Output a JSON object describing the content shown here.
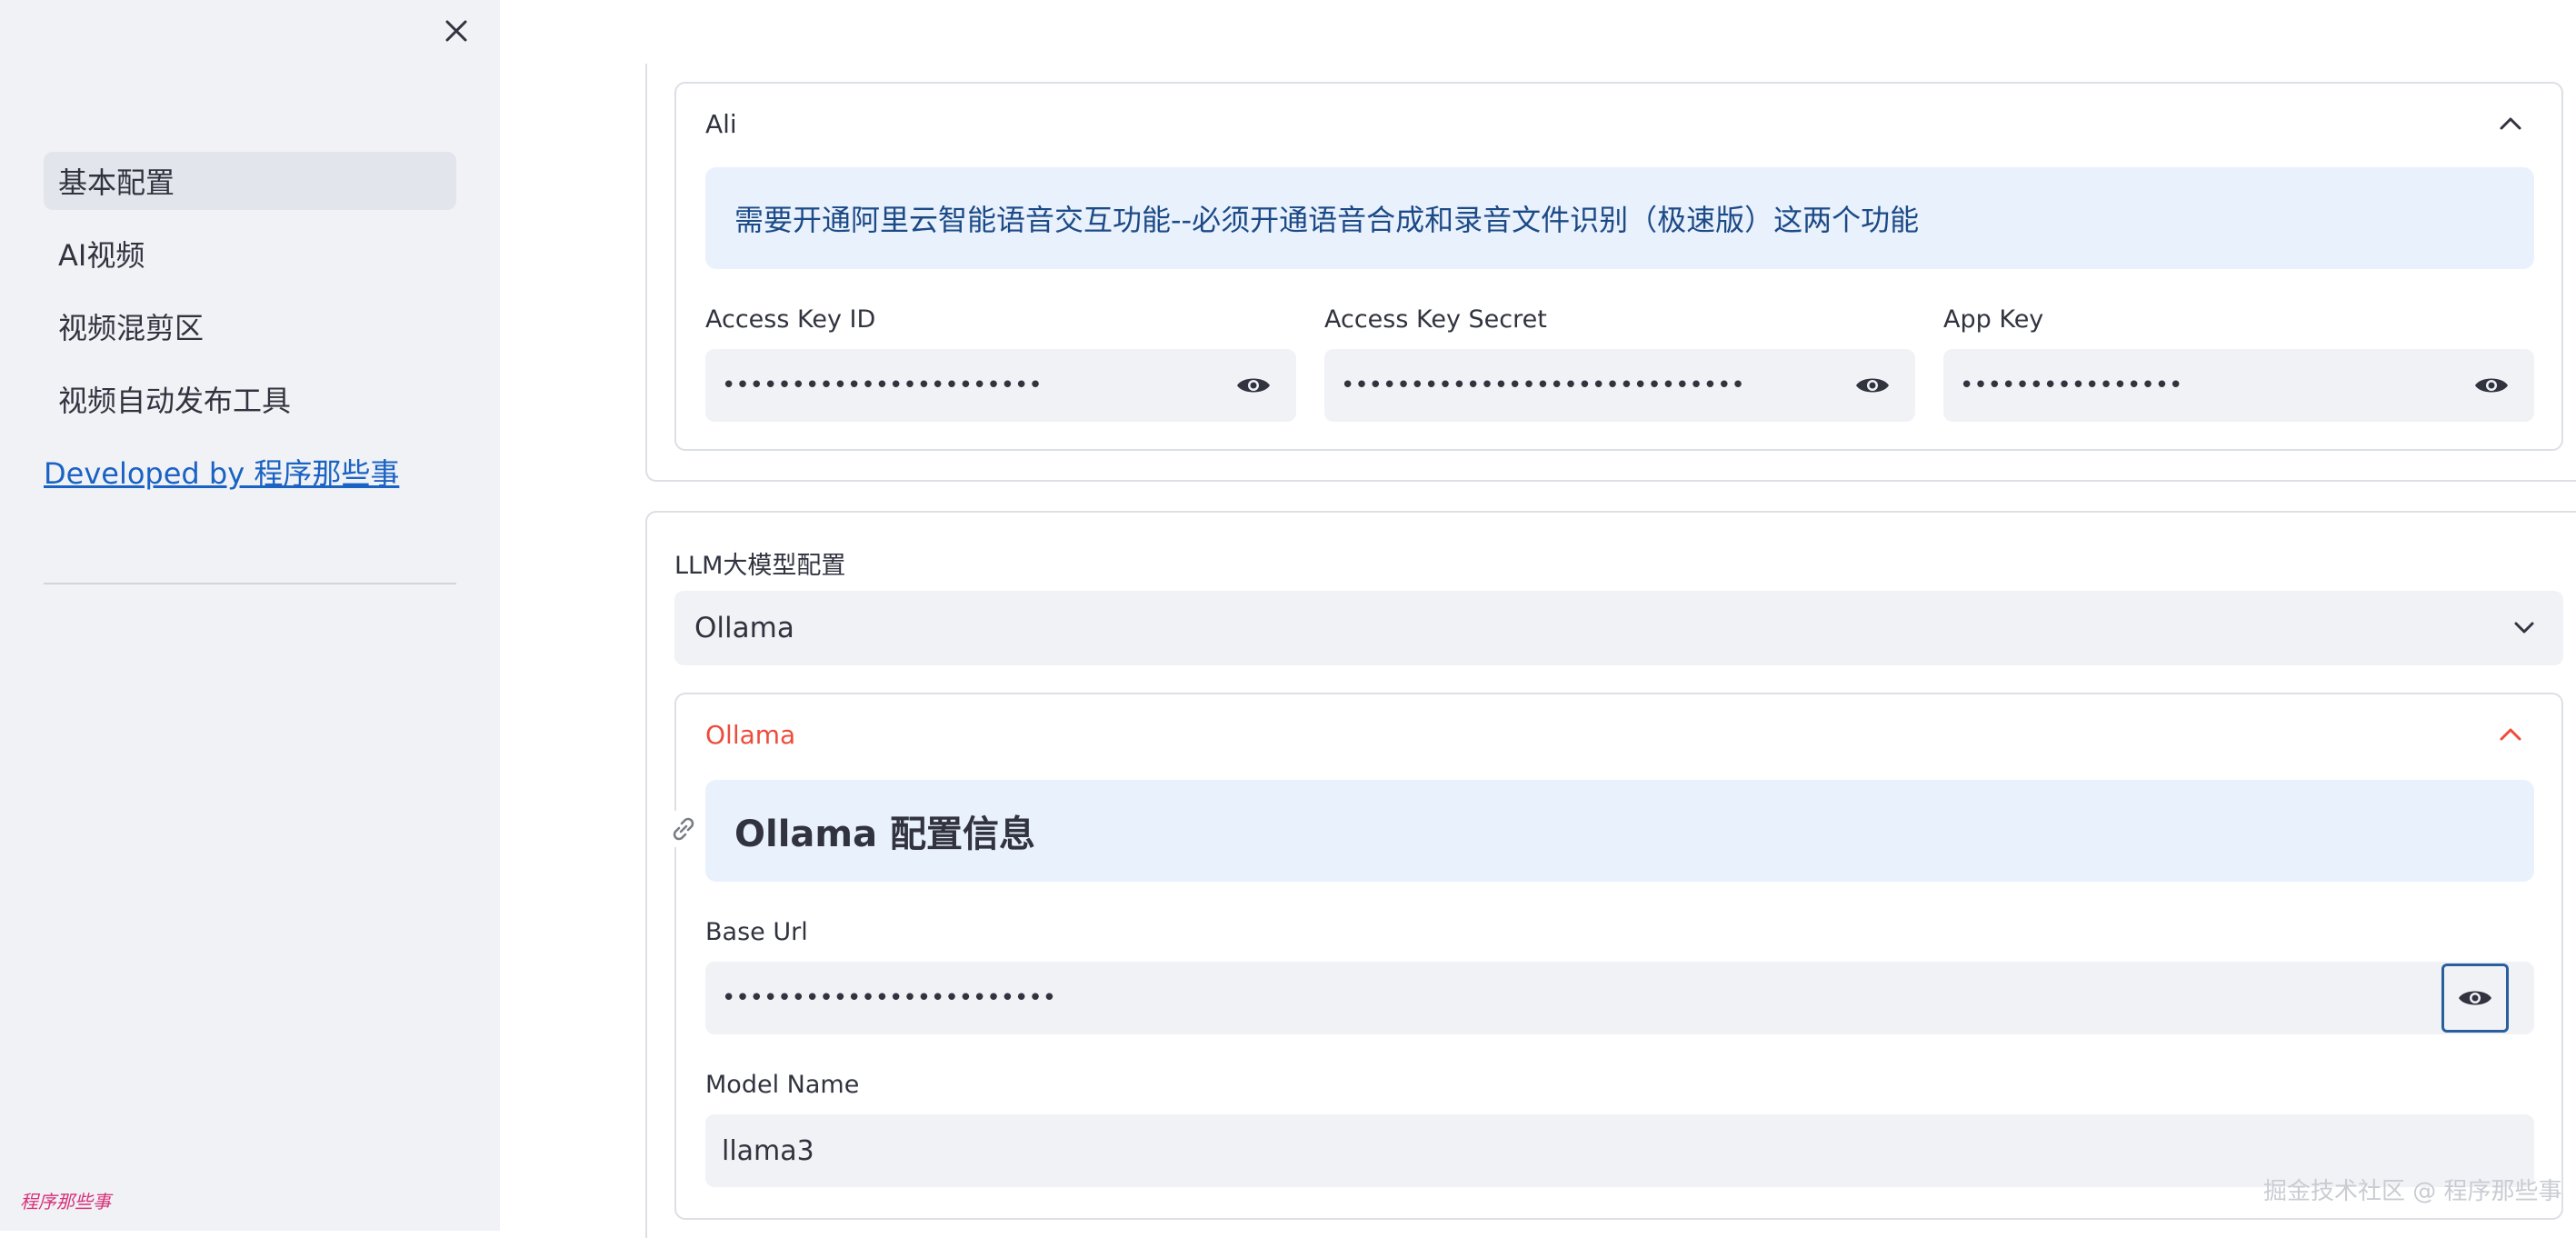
{
  "sidebar": {
    "nav_items": [
      {
        "label": "基本配置",
        "active": true
      },
      {
        "label": "AI视频",
        "active": false
      },
      {
        "label": "视频混剪区",
        "active": false
      },
      {
        "label": "视频自动发布工具",
        "active": false
      }
    ],
    "developer_link": "Developed by 程序那些事",
    "watermark": "程序那些事"
  },
  "ali": {
    "header": "Ali",
    "info": "需要开通阿里云智能语音交互功能--必须开通语音合成和录音文件识别（极速版）这两个功能",
    "fields": [
      {
        "label": "Access Key ID",
        "value": "•••••••••••••••••••••••"
      },
      {
        "label": "Access Key Secret",
        "value": "•••••••••••••••••••••••••••••"
      },
      {
        "label": "App Key",
        "value": "••••••••••••••••"
      }
    ]
  },
  "llm": {
    "label": "LLM大模型配置",
    "selected": "Ollama"
  },
  "ollama": {
    "header": "Ollama",
    "info_title": "Ollama 配置信息",
    "base_url_label": "Base Url",
    "base_url_value": "••••••••••••••••••••••••",
    "model_name_label": "Model Name",
    "model_name_value": "llama3"
  },
  "footer": {
    "watermark": "掘金技术社区 @ 程序那些事"
  },
  "colors": {
    "sidebar_bg": "#f0f2f6",
    "accent_red": "#ee4b3b",
    "link_blue": "#1a62c4",
    "info_bg": "#e9f1fd"
  }
}
